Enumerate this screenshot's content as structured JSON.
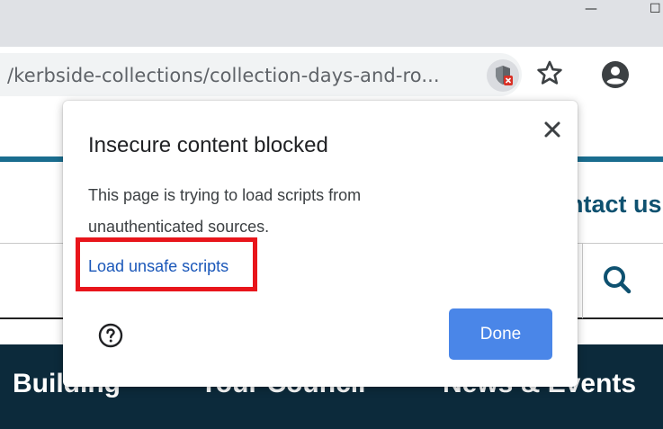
{
  "browser": {
    "window_controls": {
      "minimize": "—",
      "maximize": "☐"
    },
    "url": "/kerbside-collections/collection-days-and-ro...",
    "icons": [
      "insecure-content-shield-icon",
      "star-icon",
      "account-icon"
    ]
  },
  "page": {
    "contact_label": "ntact us",
    "nav": [
      "Building",
      "Your Council",
      "News & Events"
    ]
  },
  "popup": {
    "title": "Insecure content blocked",
    "description": "This page is trying to load scripts from unauthenticated sources.",
    "link_label": "Load unsafe scripts",
    "done_label": "Done"
  },
  "colors": {
    "link": "#1a57b9",
    "done_button": "#4a86e8",
    "highlight": "#e8151b",
    "nav_background": "#0c2a3b",
    "page_accent": "#1a6d8f"
  }
}
